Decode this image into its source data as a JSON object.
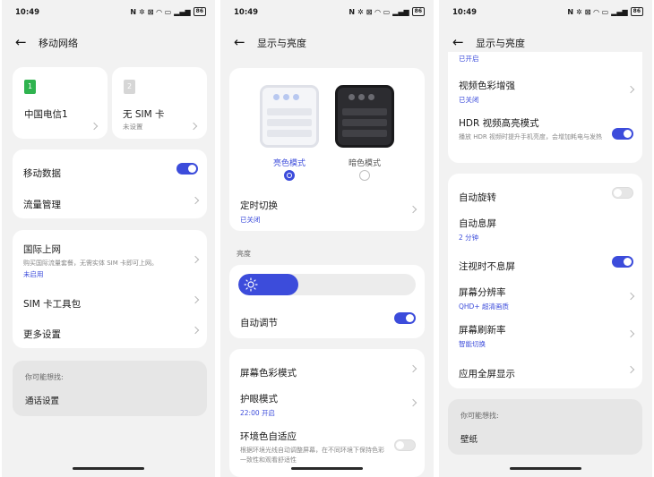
{
  "status": {
    "time": "10:49",
    "battery": "86"
  },
  "colors": {
    "accent": "#3c4cdb",
    "sim_green": "#2fb34f"
  },
  "p1": {
    "title": "移动网络",
    "sim1": {
      "index": "1",
      "name": "中国电信1"
    },
    "sim2": {
      "index": "2",
      "name": "无 SIM 卡",
      "status": "未设置"
    },
    "mobile_data": {
      "label": "移动数据",
      "on": true
    },
    "traffic": {
      "label": "流量管理"
    },
    "intl": {
      "label": "国际上网",
      "desc": "购买国际流量套餐，无需实体 SIM 卡即可上网。",
      "status": "未启用"
    },
    "simtool": {
      "label": "SIM 卡工具包"
    },
    "more": {
      "label": "更多设置"
    },
    "suggest": {
      "hint": "你可能想找:",
      "item": "通话设置"
    }
  },
  "p2": {
    "title": "显示与亮度",
    "light_mode": "亮色模式",
    "dark_mode": "暗色模式",
    "selected_mode": "light",
    "schedule": {
      "label": "定时切换",
      "status": "已关闭"
    },
    "brightness_section": "亮度",
    "brightness_level": 0.34,
    "auto_adjust": {
      "label": "自动调节",
      "on": true
    },
    "color_mode": {
      "label": "屏幕色彩模式"
    },
    "eye_care": {
      "label": "护眼模式",
      "status": "22:00 开启"
    },
    "ambient": {
      "label": "环境色自适应",
      "desc": "根据环境光线自动调整屏幕，在不同环境下保持色彩一致性和观看舒适性",
      "on": false
    }
  },
  "p3": {
    "title": "显示与亮度",
    "top_status": "已开启",
    "video_color": {
      "label": "视频色彩增强",
      "status": "已关闭"
    },
    "hdr": {
      "label": "HDR 视频高亮模式",
      "desc": "播放 HDR 视频时提升手机亮度，会增加耗电与发热",
      "on": true
    },
    "auto_rotate": {
      "label": "自动旋转",
      "on": false
    },
    "auto_sleep": {
      "label": "自动息屏",
      "status": "2 分钟"
    },
    "gaze": {
      "label": "注视时不息屏",
      "on": true
    },
    "resolution": {
      "label": "屏幕分辨率",
      "status": "QHD+ 超清画质"
    },
    "refresh": {
      "label": "屏幕刷新率",
      "status": "智能切换"
    },
    "fullscreen": {
      "label": "应用全屏显示"
    },
    "suggest": {
      "hint": "你可能想找:",
      "item": "壁纸"
    }
  }
}
